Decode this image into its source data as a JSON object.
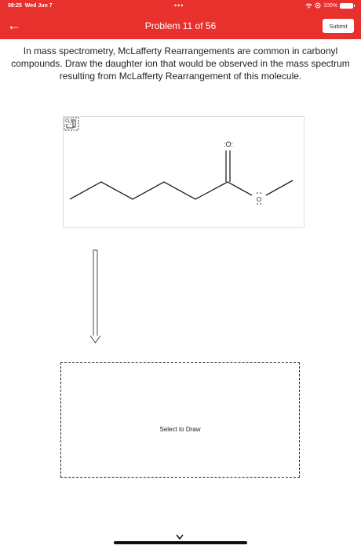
{
  "status_bar": {
    "time": "08:25",
    "date": "Wed Jun 7",
    "battery": "100%",
    "dots": "•••",
    "icons": [
      "wifi-icon",
      "orientation-lock-icon",
      "battery-icon"
    ]
  },
  "header": {
    "title": "Problem 11 of 56",
    "submit_label": "Submit",
    "back_icon": "back-arrow-icon",
    "background_color": "#e8312c"
  },
  "question": {
    "text": "In mass spectrometry, McLafferty Rearrangements are common in carbonyl compounds. Draw the daughter ion that would be observed in the mass spectrum resulting from McLafferty Rearrangement of this molecule."
  },
  "molecule": {
    "carbonyl_oxygen_label": ":O:",
    "ester_oxygen_label": "O",
    "panel_icons": [
      "expand-icon",
      "zoom-icon"
    ]
  },
  "reaction_arrow_icon": "down-arrow-icon",
  "answer_box": {
    "label": "Select to Draw"
  },
  "bottom": {
    "icons": [
      "chevron-down-icon",
      "home-indicator"
    ]
  }
}
